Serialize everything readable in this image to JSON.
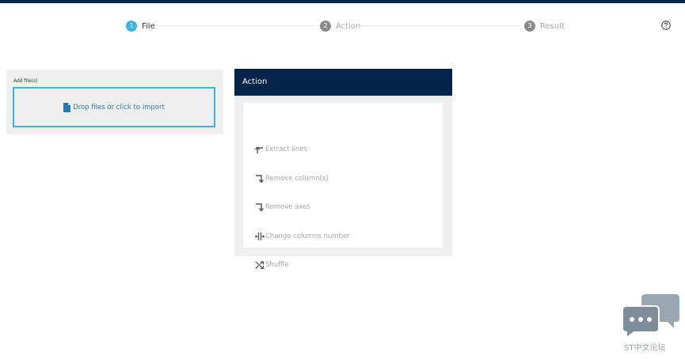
{
  "stepper": {
    "steps": [
      {
        "number": "1",
        "label": "File",
        "state": "active"
      },
      {
        "number": "2",
        "label": "Action",
        "state": "inactive"
      },
      {
        "number": "3",
        "label": "Result",
        "state": "inactive"
      }
    ],
    "help_icon": "question-circle-icon"
  },
  "files_panel": {
    "title": "Add file(s)",
    "dropzone_label": "Drop files or click to import",
    "dropzone_icon": "file-icon"
  },
  "action_panel": {
    "title": "Action",
    "items": [
      {
        "label": "Extract lines",
        "icon": "corner-up-left-arrow-icon"
      },
      {
        "label": "Remove column(s)",
        "icon": "corner-down-right-arrow-icon"
      },
      {
        "label": "Remove axes",
        "icon": "corner-down-right-arrow-icon"
      },
      {
        "label": "Change columns number",
        "icon": "columns-split-icon"
      },
      {
        "label": "Shuffle",
        "icon": "shuffle-icon"
      }
    ]
  },
  "watermark": {
    "text": "ST中文论坛",
    "icon": "chat-bubbles-icon"
  },
  "colors": {
    "navy": "#03234b",
    "accent": "#3cb4e6",
    "panel_bg": "#f0f0f0",
    "inactive_text": "#a8a8a8"
  }
}
